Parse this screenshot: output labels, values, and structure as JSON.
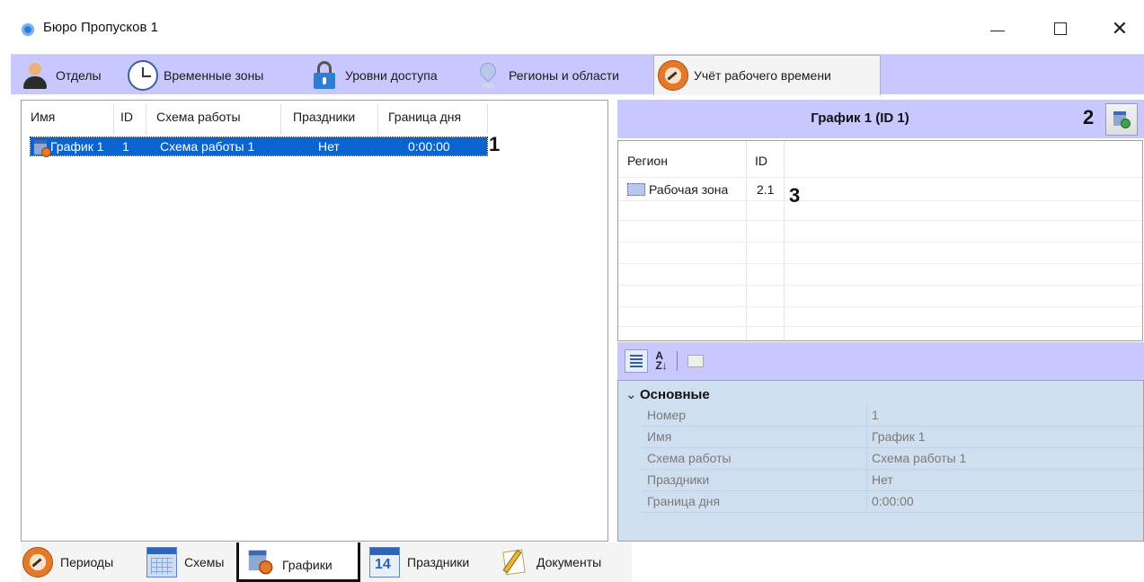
{
  "window": {
    "title": "Бюро Пропусков 1"
  },
  "top_tabs": [
    {
      "label": "Отделы",
      "icon": "person-icon"
    },
    {
      "label": "Временные зоны",
      "icon": "clock-icon"
    },
    {
      "label": "Уровни доступа",
      "icon": "lock-icon"
    },
    {
      "label": "Регионы и области",
      "icon": "map-pin-icon"
    },
    {
      "label": "Учёт рабочего времени",
      "icon": "gauge-icon",
      "active": true
    }
  ],
  "schedules_table": {
    "columns": [
      "Имя",
      "ID",
      "Схема работы",
      "Праздники",
      "Граница дня"
    ],
    "rows": [
      {
        "name": "График 1",
        "id": "1",
        "scheme": "Схема работы 1",
        "holidays": "Нет",
        "day_boundary": "0:00:00",
        "selected": true
      }
    ]
  },
  "callouts": {
    "one": "1",
    "two": "2",
    "three": "3"
  },
  "detail": {
    "title": "График 1 (ID 1)",
    "regions": {
      "columns": [
        "Регион",
        "ID"
      ],
      "rows": [
        {
          "name": "Рабочая зона",
          "id": "2.1"
        }
      ]
    }
  },
  "properties": {
    "category": "Основные",
    "rows": [
      {
        "name": "Номер",
        "value": "1"
      },
      {
        "name": "Имя",
        "value": "График 1"
      },
      {
        "name": "Схема работы",
        "value": "Схема работы 1"
      },
      {
        "name": "Праздники",
        "value": "Нет"
      },
      {
        "name": "Граница дня",
        "value": "0:00:00"
      }
    ]
  },
  "bottom_tabs": [
    {
      "label": "Периоды",
      "icon": "gauge-icon"
    },
    {
      "label": "Схемы",
      "icon": "table-icon"
    },
    {
      "label": "Графики",
      "icon": "schedule-icon",
      "active": true
    },
    {
      "label": "Праздники",
      "icon": "calendar-icon"
    },
    {
      "label": "Документы",
      "icon": "documents-icon"
    }
  ],
  "colors": {
    "tabbar": "#c8c8ff",
    "selection": "#0a64d0",
    "propgrid": "#cfdff0"
  }
}
